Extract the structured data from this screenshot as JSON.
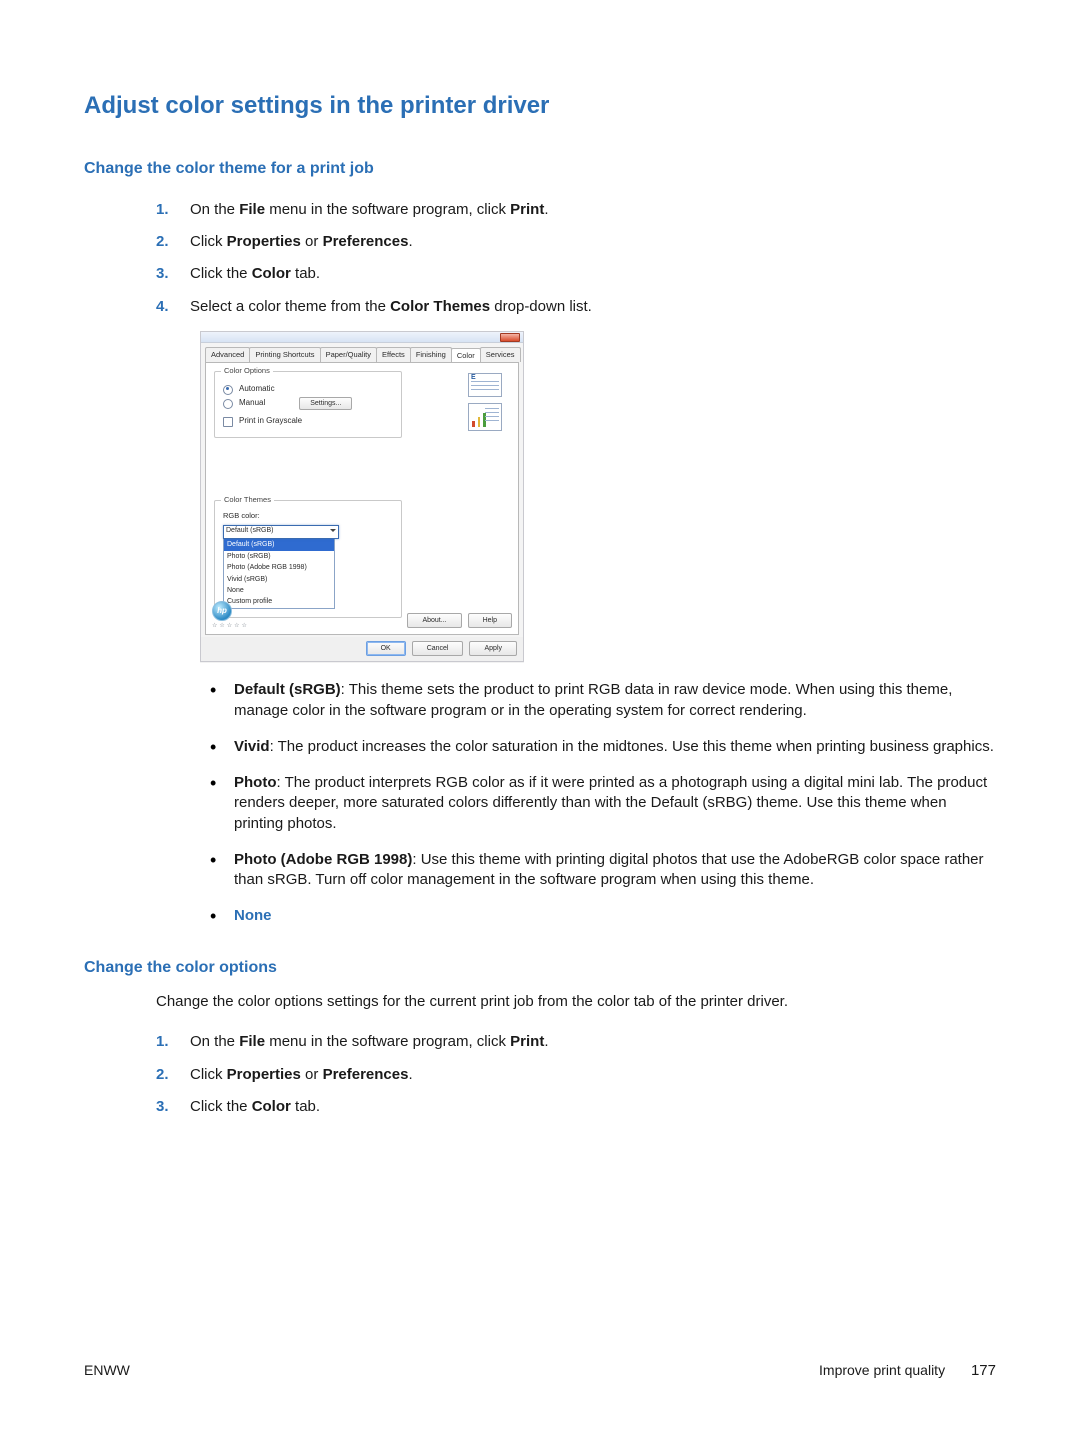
{
  "title": "Adjust color settings in the printer driver",
  "section1": {
    "heading": "Change the color theme for a print job",
    "steps": [
      {
        "n": "1.",
        "pre": "On the ",
        "b1": "File",
        "mid": " menu in the software program, click ",
        "b2": "Print",
        "post": "."
      },
      {
        "n": "2.",
        "pre": "Click ",
        "b1": "Properties",
        "mid": " or ",
        "b2": "Preferences",
        "post": "."
      },
      {
        "n": "3.",
        "pre": "Click the ",
        "b1": "Color",
        "mid": " tab.",
        "b2": "",
        "post": ""
      },
      {
        "n": "4.",
        "pre": "Select a color theme from the ",
        "b1": "Color Themes",
        "mid": " drop-down list.",
        "b2": "",
        "post": ""
      }
    ]
  },
  "bullets": [
    {
      "label": "Default (sRGB)",
      "text": ": This theme sets the product to print RGB data in raw device mode. When using this theme, manage color in the software program or in the operating system for correct rendering."
    },
    {
      "label": "Vivid",
      "text": ": The product increases the color saturation in the midtones. Use this theme when printing business graphics."
    },
    {
      "label": "Photo",
      "text": ": The product interprets RGB color as if it were printed as a photograph using a digital mini lab. The product renders deeper, more saturated colors differently than with the Default (sRBG) theme. Use this theme when printing photos."
    },
    {
      "label": "Photo (Adobe RGB 1998)",
      "text": ": Use this theme with printing digital photos that use the AdobeRGB color space rather than sRGB. Turn off color management in the software program when using this theme."
    },
    {
      "label_none": "None"
    }
  ],
  "section2": {
    "heading": "Change the color options",
    "intro": "Change the color options settings for the current print job from the color tab of the printer driver.",
    "steps": [
      {
        "n": "1.",
        "pre": "On the ",
        "b1": "File",
        "mid": " menu in the software program, click ",
        "b2": "Print",
        "post": "."
      },
      {
        "n": "2.",
        "pre": "Click ",
        "b1": "Properties",
        "mid": " or ",
        "b2": "Preferences",
        "post": "."
      },
      {
        "n": "3.",
        "pre": "Click the ",
        "b1": "Color",
        "mid": " tab.",
        "b2": "",
        "post": ""
      }
    ]
  },
  "footer": {
    "left": "ENWW",
    "right_text": "Improve print quality",
    "page": "177"
  },
  "dialog": {
    "tabs": [
      "Advanced",
      "Printing Shortcuts",
      "Paper/Quality",
      "Effects",
      "Finishing",
      "Color",
      "Services"
    ],
    "color_options": {
      "legend": "Color Options",
      "automatic": "Automatic",
      "manual": "Manual",
      "settings_btn": "Settings...",
      "grayscale": "Print in Grayscale"
    },
    "color_themes": {
      "legend": "Color Themes",
      "label": "RGB color:",
      "selected": "Default (sRGB)",
      "options": [
        "Default (sRGB)",
        "Photo (sRGB)",
        "Photo (Adobe RGB 1998)",
        "Vivid (sRGB)",
        "None",
        "Custom profile"
      ]
    },
    "buttons": {
      "about": "About...",
      "help": "Help",
      "ok": "OK",
      "cancel": "Cancel",
      "apply": "Apply"
    },
    "logo_rate": "☆☆☆☆☆"
  }
}
